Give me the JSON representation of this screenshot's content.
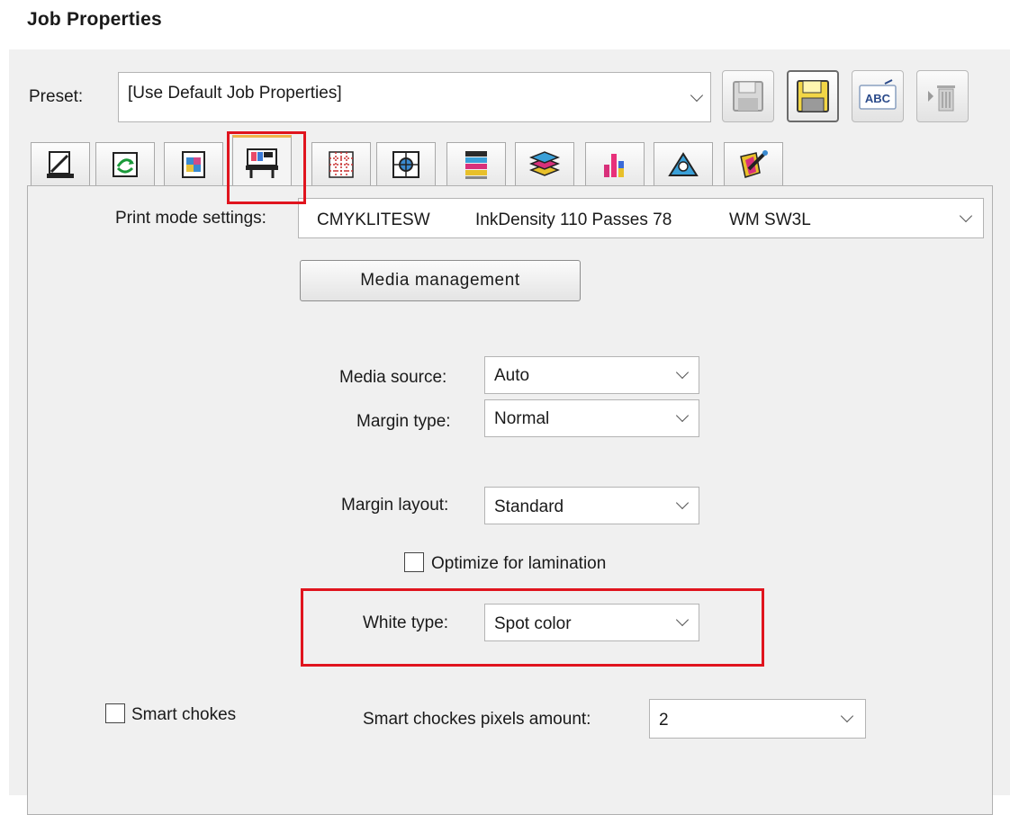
{
  "window": {
    "title": "Job Properties"
  },
  "preset": {
    "label": "Preset:",
    "value": "[Use Default Job Properties]",
    "buttons": [
      {
        "name": "save-preset-icon"
      },
      {
        "name": "save-as-preset-icon"
      },
      {
        "name": "rename-preset-icon",
        "text": "ABC"
      },
      {
        "name": "delete-preset-icon"
      }
    ]
  },
  "tabs": [
    {
      "name": "tab-page-setup-icon"
    },
    {
      "name": "tab-transform-icon"
    },
    {
      "name": "tab-image-icon"
    },
    {
      "name": "tab-printer-icon",
      "active": true
    },
    {
      "name": "tab-grid-layout-icon"
    },
    {
      "name": "tab-marks-icon"
    },
    {
      "name": "tab-color-bars-icon"
    },
    {
      "name": "tab-layers-icon"
    },
    {
      "name": "tab-ink-levels-icon"
    },
    {
      "name": "tab-shape-icon"
    },
    {
      "name": "tab-color-picker-icon"
    }
  ],
  "print_mode": {
    "label": "Print mode settings:",
    "value_mode": "CMYKLITESW",
    "value_density": "InkDensity 110 Passes 78",
    "value_wm": "WM SW3L"
  },
  "media_management_label": "Media management",
  "media_source": {
    "label": "Media source:",
    "value": "Auto"
  },
  "margin_type": {
    "label": "Margin type:",
    "value": "Normal"
  },
  "margin_layout": {
    "label": "Margin layout:",
    "value": "Standard"
  },
  "optimize_lamination": {
    "label": "Optimize for lamination",
    "checked": false
  },
  "white_type": {
    "label": "White type:",
    "value": "Spot color"
  },
  "smart_chokes": {
    "label": "Smart chokes",
    "checked": false
  },
  "smart_chokes_pixels": {
    "label": "Smart chockes pixels amount:",
    "value": "2"
  },
  "colors": {
    "highlight": "#e0141e",
    "active_tab_accent": "#f0b44a",
    "window_bg": "#f0f0f0"
  }
}
